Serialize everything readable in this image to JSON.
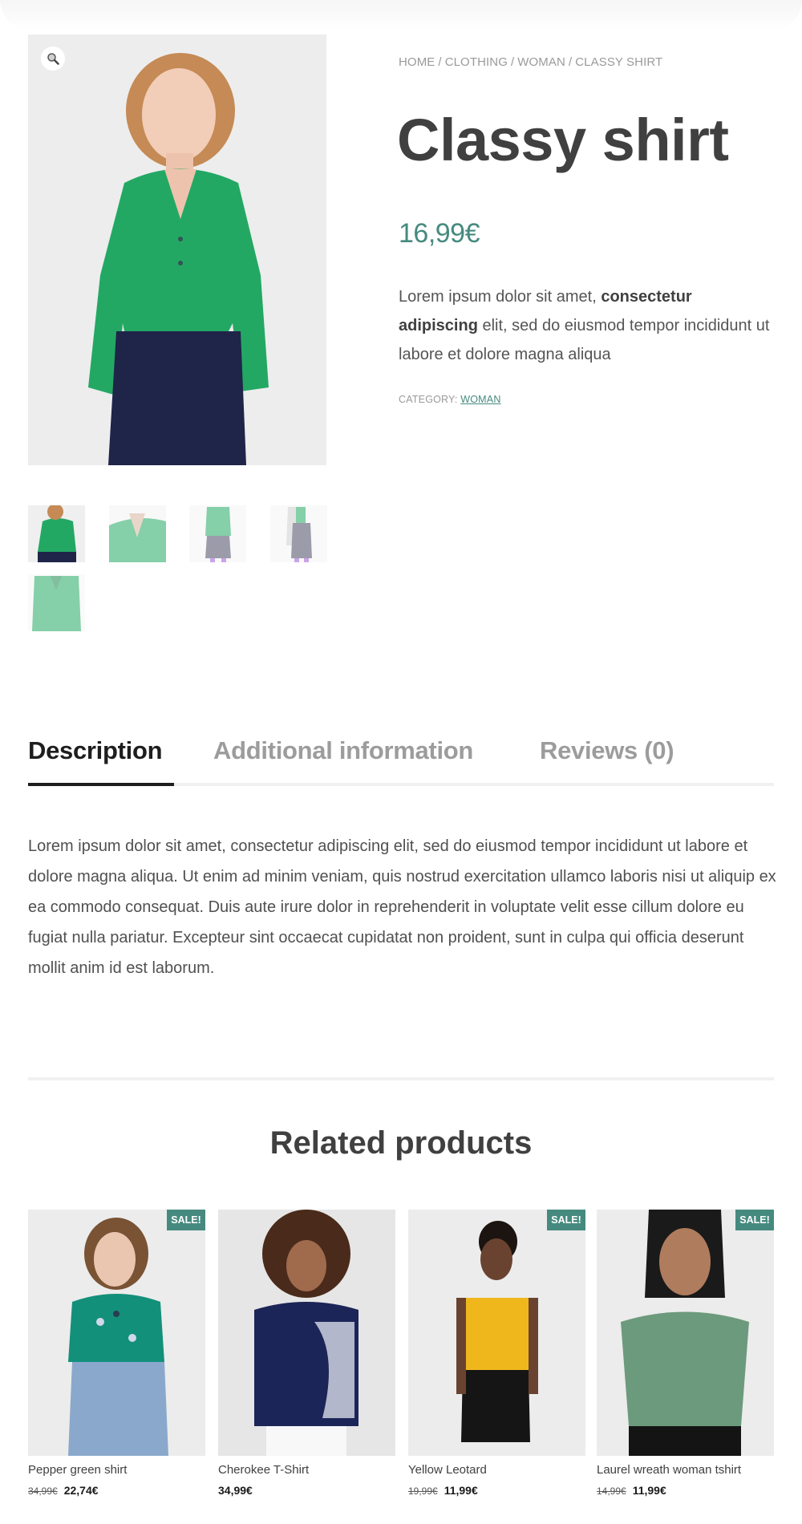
{
  "breadcrumb": {
    "items": [
      "HOME",
      "CLOTHING",
      "WOMAN",
      "CLASSY SHIRT"
    ],
    "separator": "/"
  },
  "product": {
    "title": "Classy shirt",
    "price": "16,99€",
    "short_description": {
      "part1": "Lorem ipsum dolor sit amet, ",
      "bold": "consectetur adipiscing",
      "part2": " elit, sed do eiusmod tempor incididunt ut labore et dolore magna aliqua"
    },
    "category_label": "CATEGORY:",
    "category_value": "WOMAN",
    "zoom_icon": "magnifier-icon",
    "gallery": {
      "main_image": "woman in green long-sleeve blouse and navy trousers",
      "thumbnails": [
        "green blouse front view",
        "green blouse close-up",
        "green blouse back view with grey trousers",
        "green blouse with white cardigan side view",
        "green blouse flat product view"
      ]
    }
  },
  "tabs": {
    "items": [
      "Description",
      "Additional information",
      "Reviews (0)"
    ],
    "active": "Description"
  },
  "description": "Lorem ipsum dolor sit amet, consectetur adipiscing elit, sed do eiusmod tempor incididunt ut labore et dolore magna aliqua. Ut enim ad minim veniam, quis nostrud exercitation ullamco laboris nisi ut aliquip ex ea commodo consequat. Duis aute irure dolor in reprehenderit in voluptate velit esse cillum dolore eu fugiat nulla pariatur. Excepteur sint occaecat cupidatat non proident, sunt in culpa qui officia deserunt mollit anim id est laborum.",
  "related": {
    "title": "Related products",
    "sale_label": "SALE!",
    "products": [
      {
        "name": "Pepper green shirt",
        "old_price": "34,99€",
        "price": "22,74€",
        "on_sale": true
      },
      {
        "name": "Cherokee T-Shirt",
        "old_price": "",
        "price": "34,99€",
        "on_sale": false
      },
      {
        "name": "Yellow Leotard",
        "old_price": "19,99€",
        "price": "11,99€",
        "on_sale": true
      },
      {
        "name": "Laurel wreath woman tshirt",
        "old_price": "14,99€",
        "price": "11,99€",
        "on_sale": true
      }
    ]
  },
  "colors": {
    "accent": "#468a7f",
    "text": "#404040",
    "muted": "#9a9a9a",
    "tab_active": "#1e1e1e"
  }
}
